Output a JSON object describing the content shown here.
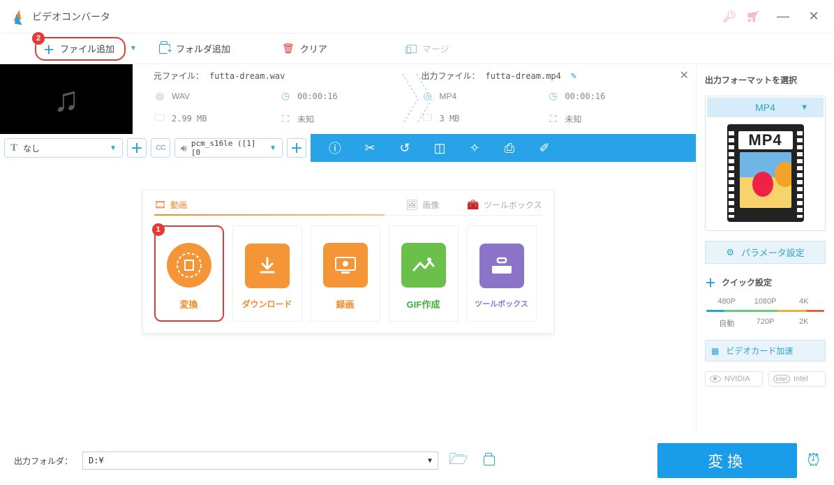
{
  "title": "ビデオコンバータ",
  "toolbar": {
    "add_file": "ファイル追加",
    "add_folder": "フォルダ追加",
    "clear": "クリア",
    "merge": "マージ",
    "badge2": "2"
  },
  "file": {
    "src_label": "元ファイル：",
    "src_name": "futta-dream.wav",
    "out_label": "出力ファイル：",
    "out_name": "futta-dream.mp4",
    "src_fmt": "WAV",
    "src_dur": "00:00:16",
    "src_size": "2.99 MB",
    "src_res": "未知",
    "out_fmt": "MP4",
    "out_dur": "00:00:16",
    "out_size": "3 MB",
    "out_res": "未知"
  },
  "ctrl": {
    "subtitle": "なし",
    "cc": "CC",
    "audio": "pcm_s16le ([1][0"
  },
  "card": {
    "tab_video": "動画",
    "tab_image": "画像",
    "tab_tools": "ツールボックス",
    "tiles": {
      "convert": "変換",
      "download": "ダウンロード",
      "record": "録画",
      "gif": "GIF作成",
      "toolbox": "ツールボックス"
    },
    "badge1": "1"
  },
  "bottom": {
    "out_folder_label": "出力フォルダ：",
    "out_folder_value": "D:¥",
    "convert": "変換"
  },
  "right": {
    "title": "出力フォーマットを選択",
    "fmt": "MP4",
    "fmt_big": "MP4",
    "param": "パラメータ設定",
    "quick": "クイック設定",
    "res": {
      "r1": "480P",
      "r2": "1080P",
      "r3": "4K",
      "r4": "自動",
      "r5": "720P",
      "r6": "2K"
    },
    "gpu": "ビデオカード加速",
    "nvidia": "NVIDIA",
    "intel": "Intel"
  }
}
